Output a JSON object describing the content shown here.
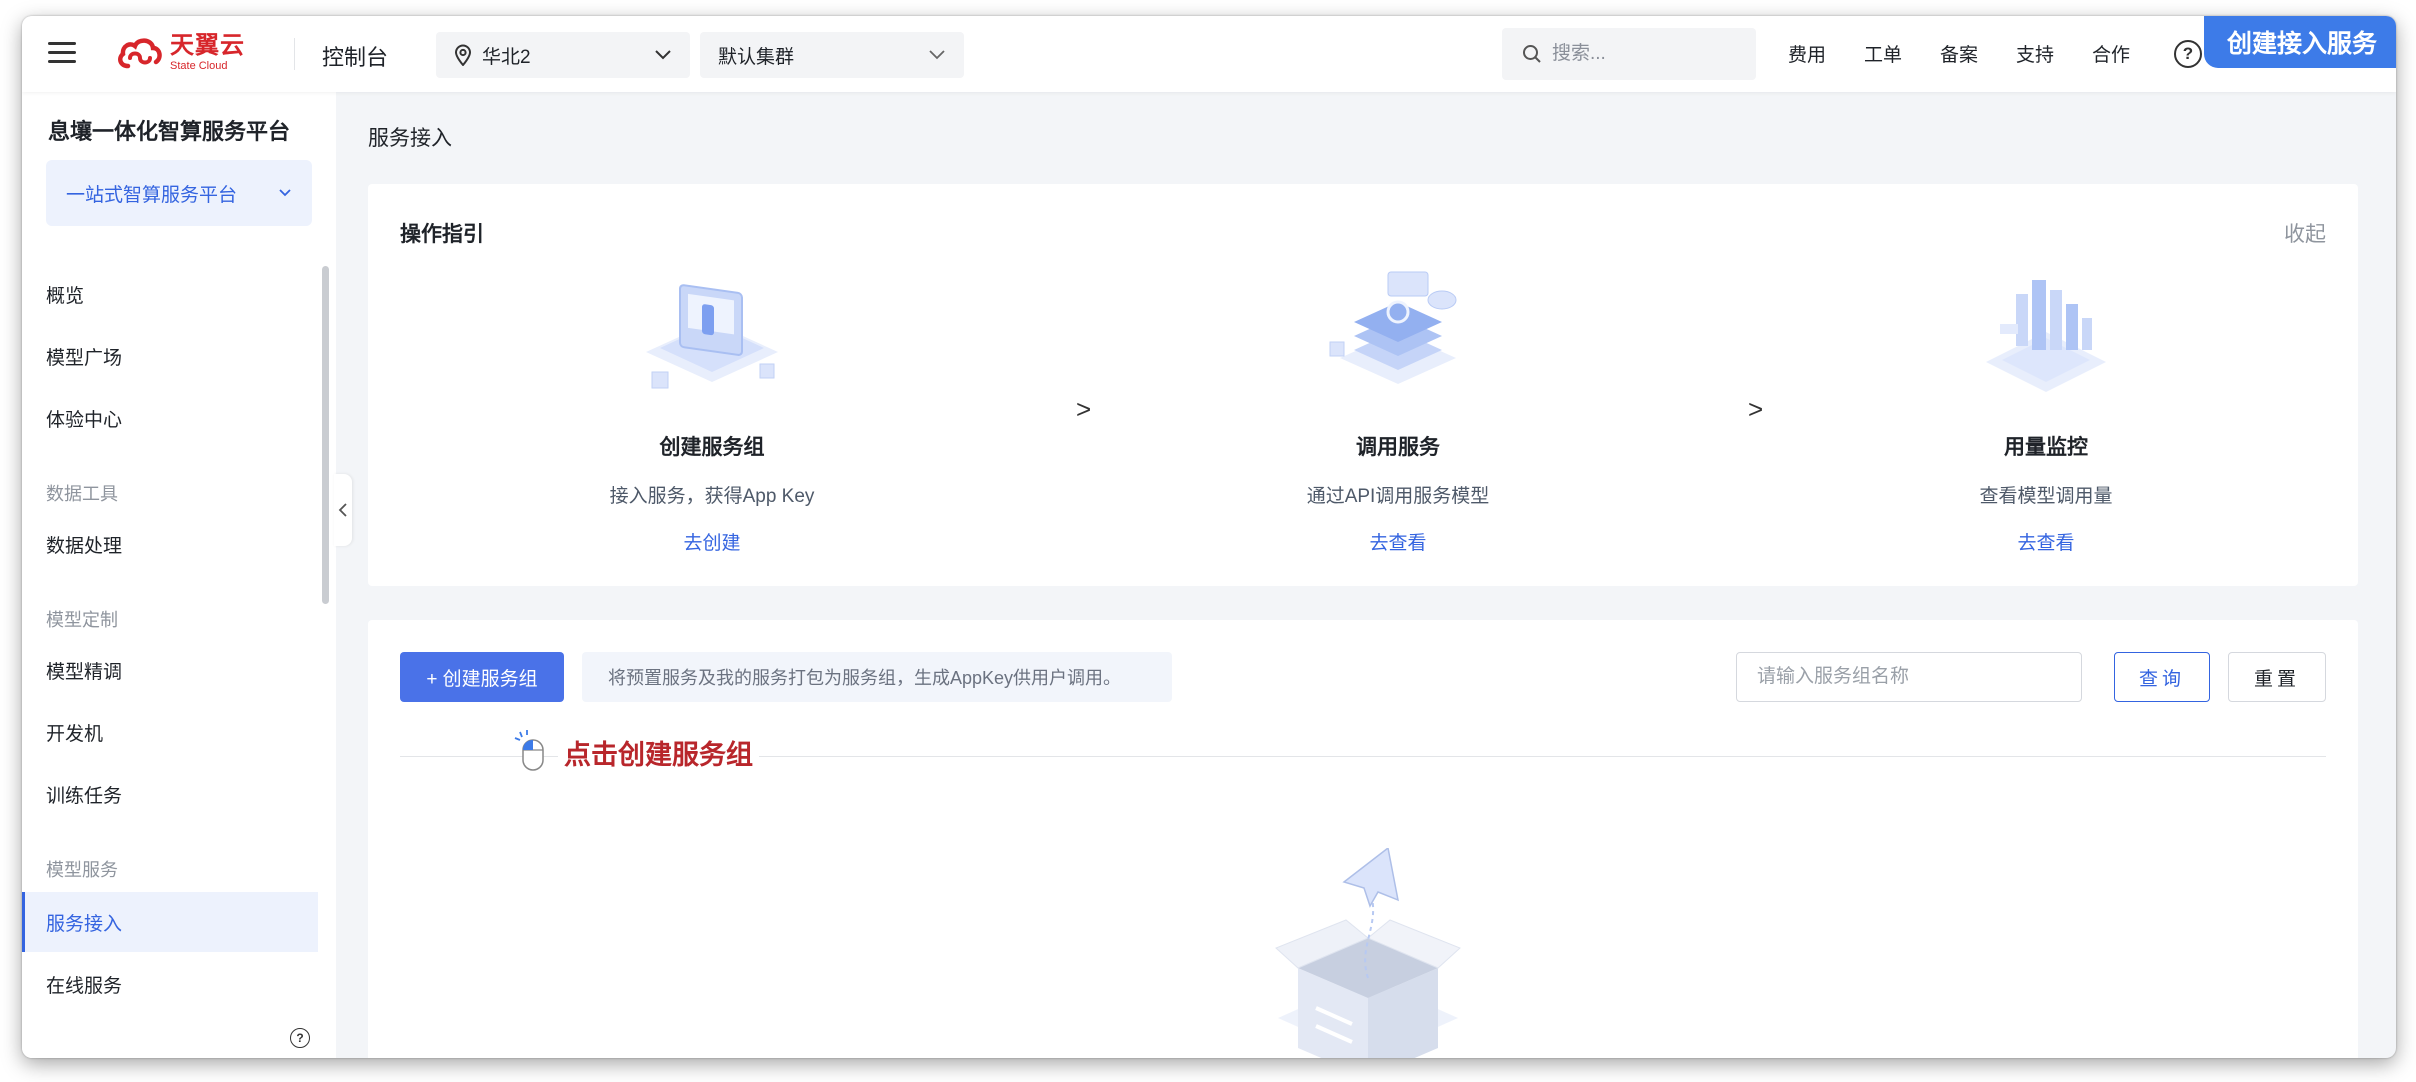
{
  "topbar": {
    "logo_cn": "天翼云",
    "logo_en": "State Cloud",
    "console_label": "控制台",
    "region": "华北2",
    "cluster": "默认集群",
    "search_placeholder": "搜索...",
    "links": [
      "费用",
      "工单",
      "备案",
      "支持",
      "合作"
    ],
    "help_symbol": "?",
    "banner": "创建接入服务"
  },
  "sidebar": {
    "platform_title": "息壤一体化智算服务平台",
    "platform_select": "一站式智算服务平台",
    "items": {
      "overview": "概览",
      "model_square": "模型广场",
      "experience": "体验中心",
      "group_data_tools": "数据工具",
      "data_processing": "数据处理",
      "group_model_custom": "模型定制",
      "fine_tuning": "模型精调",
      "dev_machine": "开发机",
      "training_tasks": "训练任务",
      "group_model_service": "模型服务",
      "service_access": "服务接入",
      "online_service": "在线服务"
    },
    "help_symbol": "?"
  },
  "main": {
    "breadcrumb": "服务接入",
    "guide": {
      "title": "操作指引",
      "collapse": "收起",
      "steps": [
        {
          "title": "创建服务组",
          "desc": "接入服务，获得App Key",
          "link": "去创建"
        },
        {
          "title": "调用服务",
          "desc": "通过API调用服务模型",
          "link": "去查看"
        },
        {
          "title": "用量监控",
          "desc": "查看模型调用量",
          "link": "去查看"
        }
      ],
      "arrow": ">"
    },
    "list": {
      "create_button": "+ 创建服务组",
      "hint": "将预置服务及我的服务打包为服务组，生成AppKey供用户调用。",
      "name_placeholder": "请输入服务组名称",
      "query_button": "查询",
      "reset_button": "重置",
      "annotation": "点击创建服务组"
    }
  },
  "colors": {
    "primary": "#3464e0",
    "banner": "#3d7be8",
    "logo_red": "#d7262b",
    "annotation_red": "#b8262b"
  }
}
